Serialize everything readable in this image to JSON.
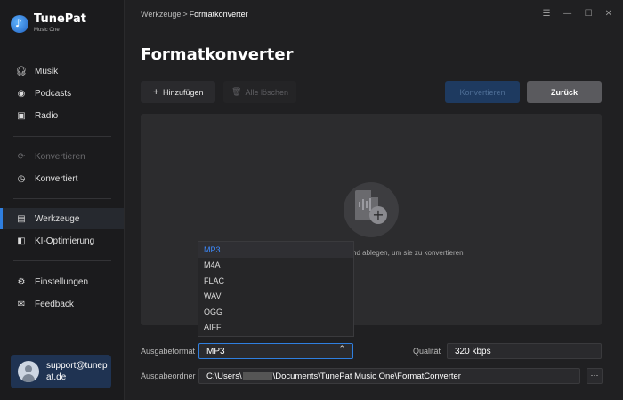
{
  "app": {
    "name": "TunePat",
    "subtitle": "Music One"
  },
  "sidebar": {
    "items": [
      {
        "label": "Musik",
        "icon": "headphones-icon"
      },
      {
        "label": "Podcasts",
        "icon": "podcast-icon"
      },
      {
        "label": "Radio",
        "icon": "radio-icon"
      },
      {
        "label": "Konvertieren",
        "icon": "convert-icon",
        "disabled": true
      },
      {
        "label": "Konvertiert",
        "icon": "clock-icon"
      },
      {
        "label": "Werkzeuge",
        "icon": "toolbox-icon",
        "active": true
      },
      {
        "label": "KI-Optimierung",
        "icon": "ai-icon"
      },
      {
        "label": "Einstellungen",
        "icon": "gear-icon"
      },
      {
        "label": "Feedback",
        "icon": "mail-icon"
      }
    ],
    "user_email": "support@tunepat.de"
  },
  "header": {
    "breadcrumb_parent": "Werkzeuge",
    "breadcrumb_sep": ">",
    "breadcrumb_current": "Formatkonverter",
    "window_controls": [
      "☰",
      "—",
      "☐",
      "✕"
    ]
  },
  "main": {
    "title": "Formatkonverter",
    "toolbar": {
      "add_label": "Hinzufügen",
      "clear_label": "Alle löschen",
      "convert_label": "Konvertieren",
      "back_label": "Zurück"
    },
    "dropzone_text": "nd ablegen, um sie zu konvertieren",
    "format_dropdown": {
      "options": [
        "MP3",
        "M4A",
        "FLAC",
        "WAV",
        "OGG",
        "AIFF"
      ],
      "selected": "MP3"
    },
    "output_format_label": "Ausgabeformat",
    "output_format_value": "MP3",
    "quality_label": "Qualität",
    "quality_value": "320 kbps",
    "output_folder_label": "Ausgabeordner",
    "output_path_prefix": "C:\\Users\\",
    "output_path_suffix": "\\Documents\\TunePat Music One\\FormatConverter",
    "browse_label": "···"
  },
  "colors": {
    "accent": "#2f7fe0",
    "background": "#202022",
    "sidebar": "#1b1b1d"
  }
}
